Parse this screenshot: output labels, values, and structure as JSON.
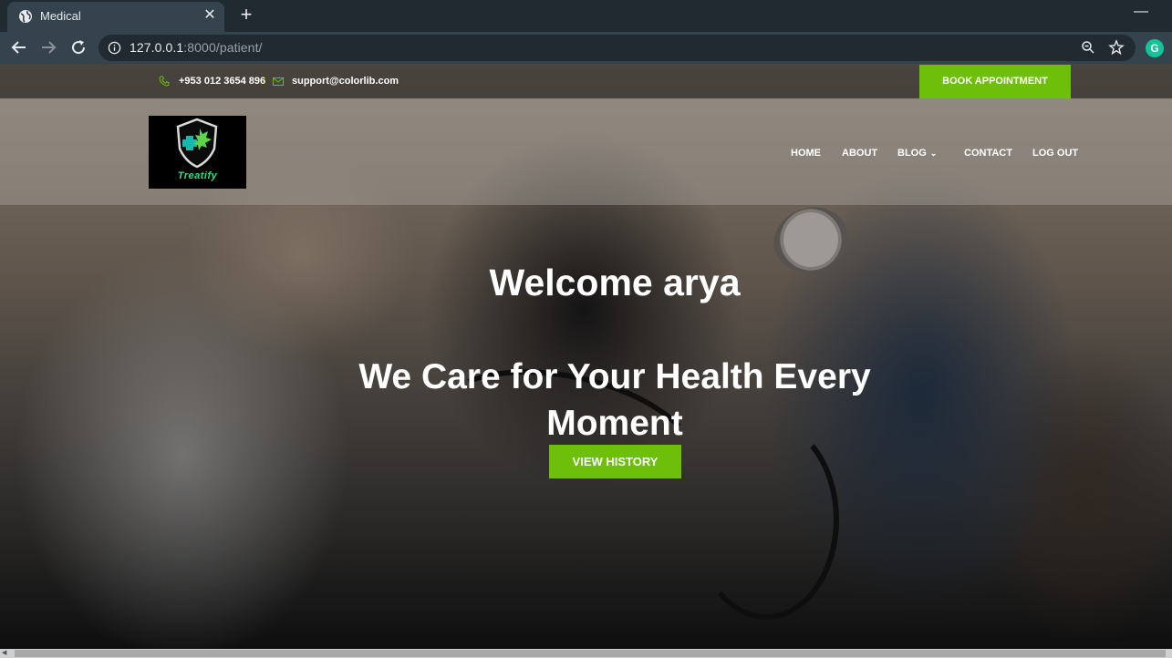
{
  "browser": {
    "tab_title": "Medical",
    "close_symbol": "✕",
    "new_tab_symbol": "+",
    "minimize_symbol": "—",
    "url_host": "127.0.0.1",
    "url_rest": ":8000/patient/",
    "extension_letter": "G"
  },
  "topbar": {
    "phone": "+953 012 3654 896",
    "email": "support@colorlib.com",
    "book_button": "BOOK APPOINTMENT"
  },
  "logo": {
    "text": "Treatify"
  },
  "nav": {
    "items": [
      {
        "label": "HOME"
      },
      {
        "label": "ABOUT"
      },
      {
        "label": "BLOG"
      },
      {
        "label": "CONTACT"
      },
      {
        "label": "LOG OUT"
      }
    ],
    "dropdown_symbol": "⌄"
  },
  "hero": {
    "welcome": "Welcome arya",
    "tagline": "We Care for Your Health Every Moment",
    "history_button": "VIEW HISTORY"
  },
  "colors": {
    "accent": "#6dbf0a",
    "chrome_dark": "#202a30",
    "chrome_light": "#35434c"
  }
}
